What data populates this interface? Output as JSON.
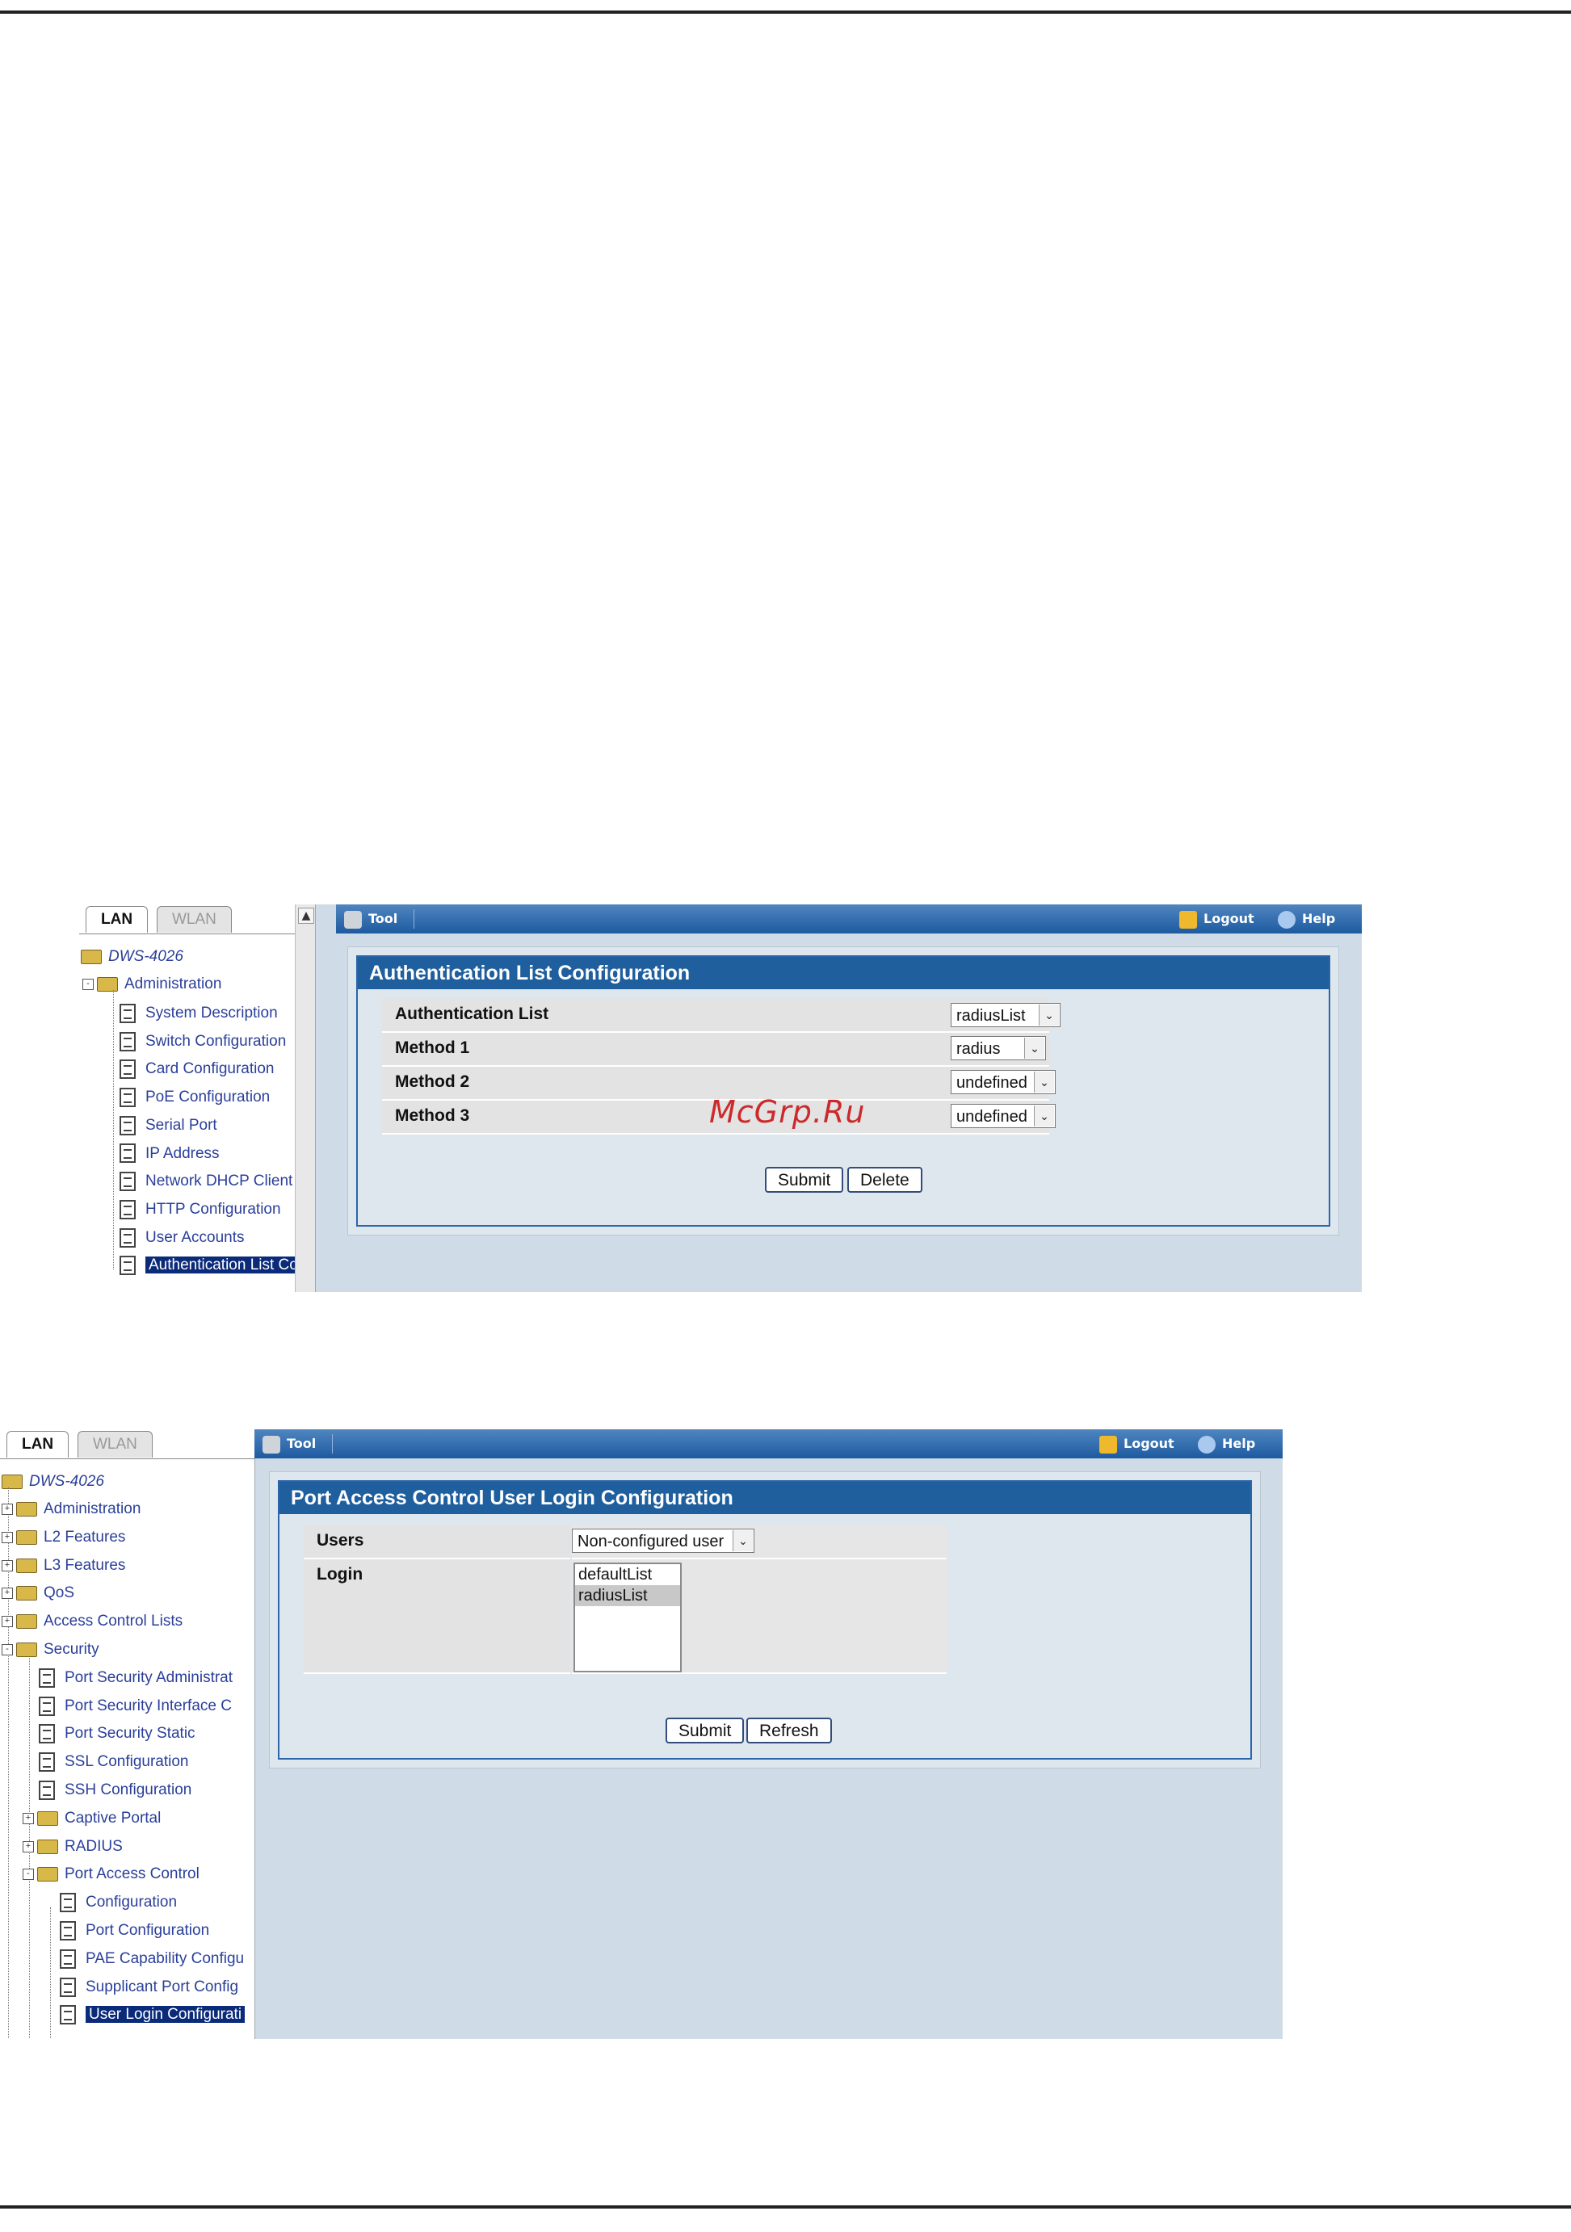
{
  "screenshot1": {
    "tabs": {
      "lan": "LAN",
      "wlan": "WLAN"
    },
    "tree": {
      "root": "DWS-4026",
      "group": "Administration",
      "items": [
        "System Description",
        "Switch Configuration",
        "Card Configuration",
        "PoE Configuration",
        "Serial Port",
        "IP Address",
        "Network DHCP Client (",
        "HTTP Configuration",
        "User Accounts",
        "Authentication List Cor"
      ],
      "selected": "Authentication List Cor"
    },
    "toolbar": {
      "tool": "Tool",
      "logout": "Logout",
      "help": "Help"
    },
    "panel": {
      "title": "Authentication List Configuration",
      "fields": [
        {
          "label": "Authentication List",
          "value": "radiusList"
        },
        {
          "label": "Method 1",
          "value": "radius"
        },
        {
          "label": "Method 2",
          "value": "undefined"
        },
        {
          "label": "Method 3",
          "value": "undefined"
        }
      ],
      "buttons": {
        "submit": "Submit",
        "delete": "Delete"
      }
    }
  },
  "watermark": "McGrp.Ru",
  "screenshot2": {
    "tabs": {
      "lan": "LAN",
      "wlan": "WLAN"
    },
    "tree": {
      "root": "DWS-4026",
      "nodes": [
        {
          "label": "Administration",
          "type": "folder",
          "expander": "+"
        },
        {
          "label": "L2 Features",
          "type": "folder",
          "expander": "+"
        },
        {
          "label": "L3 Features",
          "type": "folder",
          "expander": "+"
        },
        {
          "label": "QoS",
          "type": "folder",
          "expander": "+"
        },
        {
          "label": "Access Control Lists",
          "type": "folder",
          "expander": "+"
        },
        {
          "label": "Security",
          "type": "folder",
          "expander": "-"
        },
        {
          "label": "Port Security Administrat",
          "type": "doc"
        },
        {
          "label": "Port Security Interface C",
          "type": "doc"
        },
        {
          "label": "Port Security Static",
          "type": "doc"
        },
        {
          "label": "SSL Configuration",
          "type": "doc"
        },
        {
          "label": "SSH Configuration",
          "type": "doc"
        },
        {
          "label": "Captive Portal",
          "type": "folder",
          "expander": "+"
        },
        {
          "label": "RADIUS",
          "type": "folder",
          "expander": "+"
        },
        {
          "label": "Port Access Control",
          "type": "folder",
          "expander": "-"
        },
        {
          "label": "Configuration",
          "type": "doc"
        },
        {
          "label": "Port Configuration",
          "type": "doc"
        },
        {
          "label": "PAE Capability Configu",
          "type": "doc"
        },
        {
          "label": "Supplicant Port Config",
          "type": "doc"
        },
        {
          "label": "User Login Configurati",
          "type": "doc"
        }
      ],
      "selected": "User Login Configurati"
    },
    "toolbar": {
      "tool": "Tool",
      "logout": "Logout",
      "help": "Help"
    },
    "panel": {
      "title": "Port Access Control User Login Configuration",
      "users_label": "Users",
      "users_value": "Non-configured user",
      "login_label": "Login",
      "login_options": [
        "defaultList",
        "radiusList"
      ],
      "login_selected": "radiusList",
      "buttons": {
        "submit": "Submit",
        "refresh": "Refresh"
      }
    }
  }
}
